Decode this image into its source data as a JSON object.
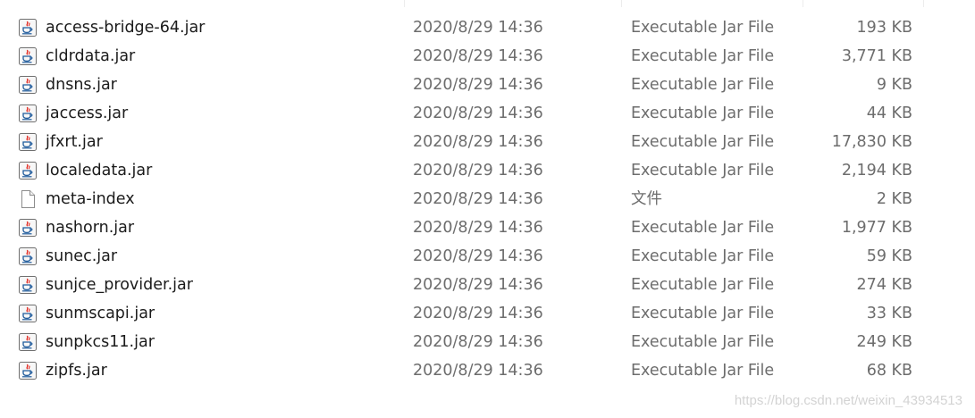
{
  "files": [
    {
      "name": "access-bridge-64.jar",
      "date": "2020/8/29 14:36",
      "type": "Executable Jar File",
      "size": "193 KB",
      "icon": "java-jar-icon"
    },
    {
      "name": "cldrdata.jar",
      "date": "2020/8/29 14:36",
      "type": "Executable Jar File",
      "size": "3,771 KB",
      "icon": "java-jar-icon"
    },
    {
      "name": "dnsns.jar",
      "date": "2020/8/29 14:36",
      "type": "Executable Jar File",
      "size": "9 KB",
      "icon": "java-jar-icon"
    },
    {
      "name": "jaccess.jar",
      "date": "2020/8/29 14:36",
      "type": "Executable Jar File",
      "size": "44 KB",
      "icon": "java-jar-icon"
    },
    {
      "name": "jfxrt.jar",
      "date": "2020/8/29 14:36",
      "type": "Executable Jar File",
      "size": "17,830 KB",
      "icon": "java-jar-icon"
    },
    {
      "name": "localedata.jar",
      "date": "2020/8/29 14:36",
      "type": "Executable Jar File",
      "size": "2,194 KB",
      "icon": "java-jar-icon"
    },
    {
      "name": "meta-index",
      "date": "2020/8/29 14:36",
      "type": "文件",
      "size": "2 KB",
      "icon": "blank-file-icon"
    },
    {
      "name": "nashorn.jar",
      "date": "2020/8/29 14:36",
      "type": "Executable Jar File",
      "size": "1,977 KB",
      "icon": "java-jar-icon"
    },
    {
      "name": "sunec.jar",
      "date": "2020/8/29 14:36",
      "type": "Executable Jar File",
      "size": "59 KB",
      "icon": "java-jar-icon"
    },
    {
      "name": "sunjce_provider.jar",
      "date": "2020/8/29 14:36",
      "type": "Executable Jar File",
      "size": "274 KB",
      "icon": "java-jar-icon"
    },
    {
      "name": "sunmscapi.jar",
      "date": "2020/8/29 14:36",
      "type": "Executable Jar File",
      "size": "33 KB",
      "icon": "java-jar-icon"
    },
    {
      "name": "sunpkcs11.jar",
      "date": "2020/8/29 14:36",
      "type": "Executable Jar File",
      "size": "249 KB",
      "icon": "java-jar-icon"
    },
    {
      "name": "zipfs.jar",
      "date": "2020/8/29 14:36",
      "type": "Executable Jar File",
      "size": "68 KB",
      "icon": "java-jar-icon"
    }
  ],
  "watermark": "https://blog.csdn.net/weixin_43934513",
  "colors": {
    "name_text": "#1b1b1b",
    "detail_text": "#6d6d6d",
    "java_red": "#e2231a",
    "java_blue": "#1f5b9c",
    "watermark": "#d3d3d3"
  }
}
